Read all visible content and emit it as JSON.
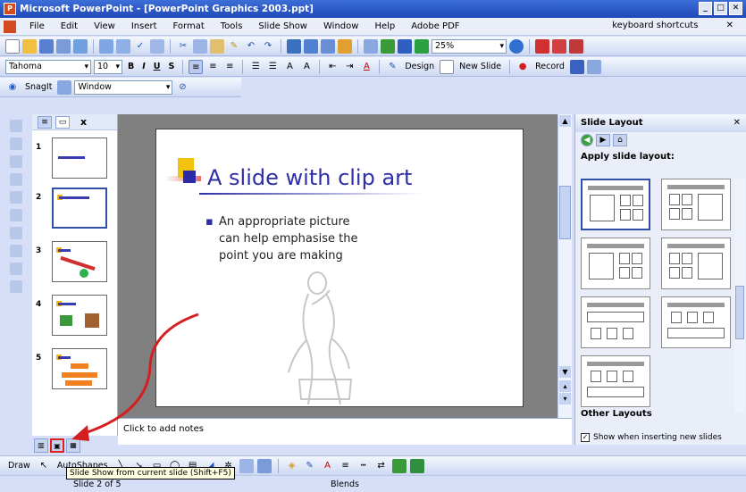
{
  "window": {
    "title": "Microsoft PowerPoint - [PowerPoint Graphics 2003.ppt]",
    "controls": [
      "_",
      "□",
      "✕"
    ]
  },
  "menu": {
    "items": [
      "File",
      "Edit",
      "View",
      "Insert",
      "Format",
      "Tools",
      "Slide Show",
      "Window",
      "Help",
      "Adobe PDF"
    ],
    "help_box": "keyboard shortcuts",
    "close": "✕"
  },
  "standard_toolbar": {
    "zoom": "25%"
  },
  "format_toolbar": {
    "font": "Tahoma",
    "size": "10",
    "bold": "B",
    "italic": "I",
    "underline": "U",
    "shadow": "S",
    "design": "Design",
    "new_slide": "New Slide",
    "record": "Record"
  },
  "snagit_toolbar": {
    "snagit": "SnagIt",
    "window_label": "Window"
  },
  "thumbnails": {
    "numbers": [
      "1",
      "2",
      "3",
      "4",
      "5"
    ],
    "close": "x"
  },
  "slide": {
    "title": "A slide with clip art",
    "bullet": "An appropriate picture can help emphasise the point you are making"
  },
  "task_pane": {
    "title": "Slide Layout",
    "apply_label": "Apply slide layout:",
    "other_layouts": "Other Layouts",
    "show_checkbox": "Show when inserting new slides",
    "close": "✕"
  },
  "notes": {
    "placeholder": "Click to add notes"
  },
  "drawing_toolbar": {
    "draw": "Draw",
    "autoshapes": "AutoShapes"
  },
  "tooltip": "Slide Show from current slide (Shift+F5)",
  "status": {
    "slide": "Slide 2 of 5",
    "design": "Blends"
  }
}
